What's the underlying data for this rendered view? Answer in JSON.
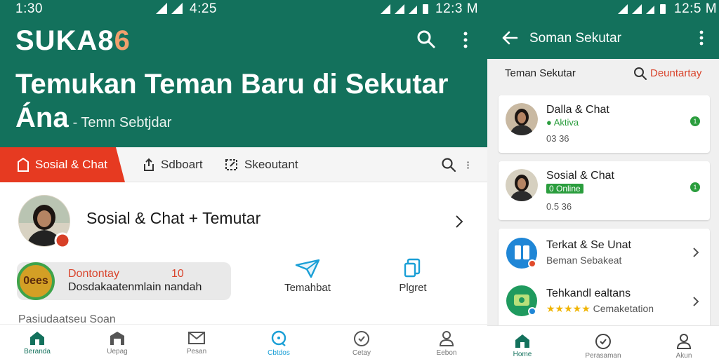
{
  "left": {
    "status": {
      "time_left": "1:30",
      "time_center": "4:25",
      "time_right": "12:3 M"
    },
    "brand": {
      "main": "SUKA8",
      "accent": "6"
    },
    "hero": {
      "title": "Temukan Teman Baru di Sekutar Ána",
      "subtitle": "- Temn Sebtjdar"
    },
    "tabs": [
      {
        "label": "Sosial & Chat",
        "active": true
      },
      {
        "label": "Sdboart"
      },
      {
        "label": "Skeoutant"
      }
    ],
    "profile": {
      "title": "Sosial & Chat + Temutar"
    },
    "promo": {
      "badge": "0ees",
      "title": "Dontontay",
      "count": "10",
      "desc": "Dosdakaatenmlain nandah"
    },
    "actions": [
      {
        "label": "Temahbat"
      },
      {
        "label": "Plgret"
      }
    ],
    "section_label": "Pasiudaatseu Soan",
    "bottom_nav": [
      {
        "label": "Beranda",
        "icon": "home-icon",
        "color": "#13715c"
      },
      {
        "label": "Uepag",
        "icon": "store-icon"
      },
      {
        "label": "Pesan",
        "icon": "mail-icon"
      },
      {
        "label": "Cbtdos",
        "icon": "chat-icon",
        "color": "#1a9fd6"
      },
      {
        "label": "Cetay",
        "icon": "clock-icon"
      },
      {
        "label": "Eebon",
        "icon": "user-icon"
      }
    ]
  },
  "right": {
    "status": {
      "time": "12:5 M"
    },
    "header": {
      "title": "Soman Sekutar"
    },
    "sub": {
      "left": "Teman Sekutar",
      "right": "Deuntartay"
    },
    "cards": [
      {
        "name": "Dalla & Chat",
        "status": "Aktiva",
        "meta": "03 36",
        "badge": "1"
      },
      {
        "name": "Sosial & Chat",
        "status": "0 Online",
        "meta": "0.5 36",
        "badge": "1"
      },
      {
        "name": "Terkat & Se Unat",
        "meta": "Beman Sebakeat"
      },
      {
        "name": "Tehkandl ealtans",
        "stars": "★★★★★",
        "meta": "Cemaketation"
      }
    ],
    "bottom_nav": [
      {
        "label": "Home",
        "icon": "home-icon"
      },
      {
        "label": "Perasaman",
        "icon": "clock-icon"
      },
      {
        "label": "Akun",
        "icon": "user-icon"
      }
    ]
  }
}
